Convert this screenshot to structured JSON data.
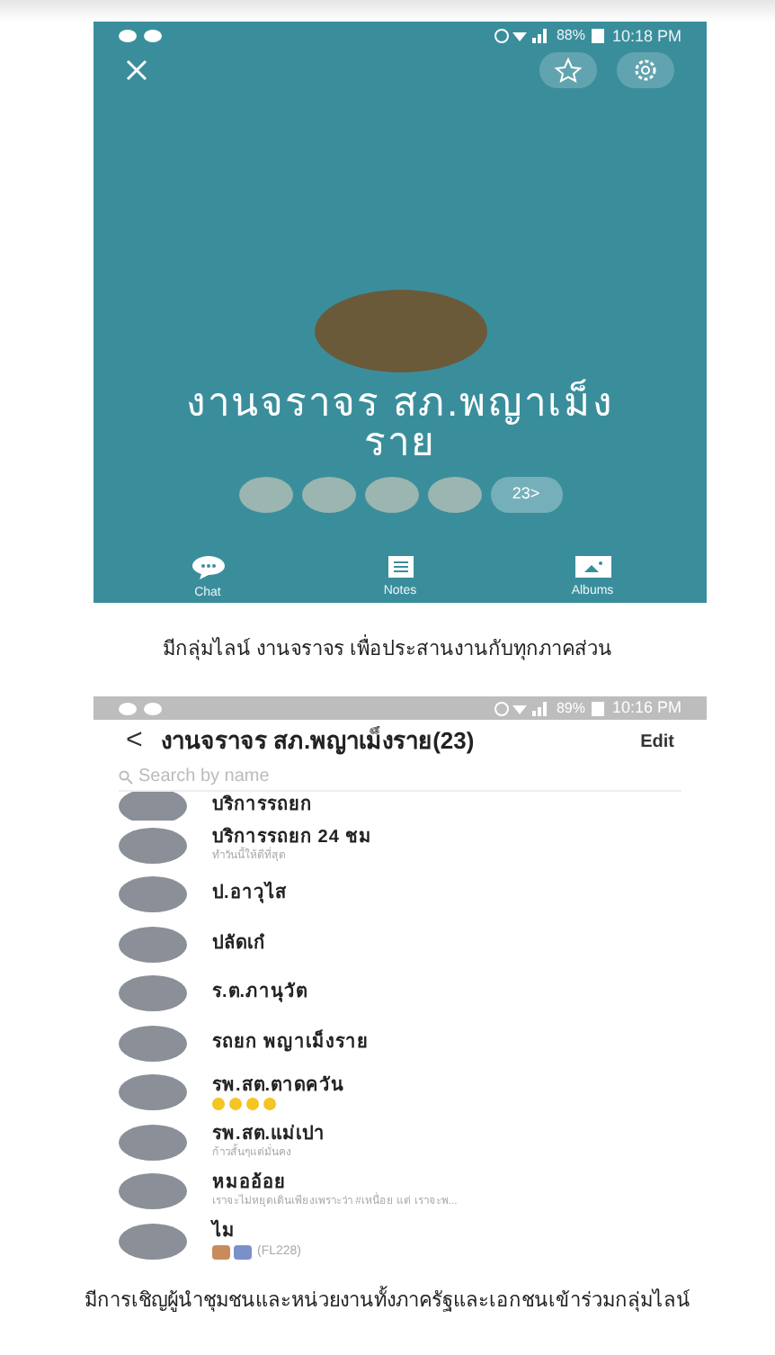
{
  "profile_screen": {
    "status_bar": {
      "battery": "88%",
      "time": "10:18 PM"
    },
    "group_name": "งานจราจร สภ.พญาเม็งราย",
    "member_count": "23>",
    "actions": [
      {
        "kind": "chat",
        "label": "Chat"
      },
      {
        "kind": "notes",
        "label": "Notes"
      },
      {
        "kind": "albums",
        "label": "Albums"
      }
    ]
  },
  "caption_1": "มีกลุ่มไลน์ งานจราจร เพื่อประสานงานกับทุกภาคส่วน",
  "members_screen": {
    "status_bar": {
      "battery": "89%",
      "time": "10:16 PM"
    },
    "back": "<",
    "title": "งานจราจร สภ.พญาเม็งราย(23)",
    "edit": "Edit",
    "search": {
      "placeholder": "Search by name"
    },
    "members": [
      {
        "name": "บริการรถยก",
        "kind": "plain"
      },
      {
        "name": "บริการรถยก 24 ชม",
        "kind": "status",
        "status": "ทำวันนี้ให้ดีที่สุด"
      },
      {
        "name": "ป.อาวุไส",
        "kind": "plain"
      },
      {
        "name": "ปลัดเก๋",
        "kind": "plain"
      },
      {
        "name": "ร.ต.ภานุวัต",
        "kind": "plain"
      },
      {
        "name": "รถยก พญาเม็งราย",
        "kind": "plain"
      },
      {
        "name": "รพ.สต.ตาดควัน",
        "kind": "emoji"
      },
      {
        "name": "รพ.สต.แม่เปา",
        "kind": "status",
        "status": "ก้าวสั้นๆแต่มั่นคง"
      },
      {
        "name": "หมออ้อย",
        "kind": "status",
        "status": "เราจะไม่หยุดเดินเพียงเพราะว่า #เหนื่อย แต่ เราจะพ..."
      },
      {
        "name": "ไม",
        "kind": "sticker",
        "status": "(FL228)"
      }
    ]
  },
  "caption_2": "มีการเชิญผู้นำชุมชนและหน่วยงานทั้งภาครัฐและเอกชนเข้าร่วมกลุ่มไลน์"
}
